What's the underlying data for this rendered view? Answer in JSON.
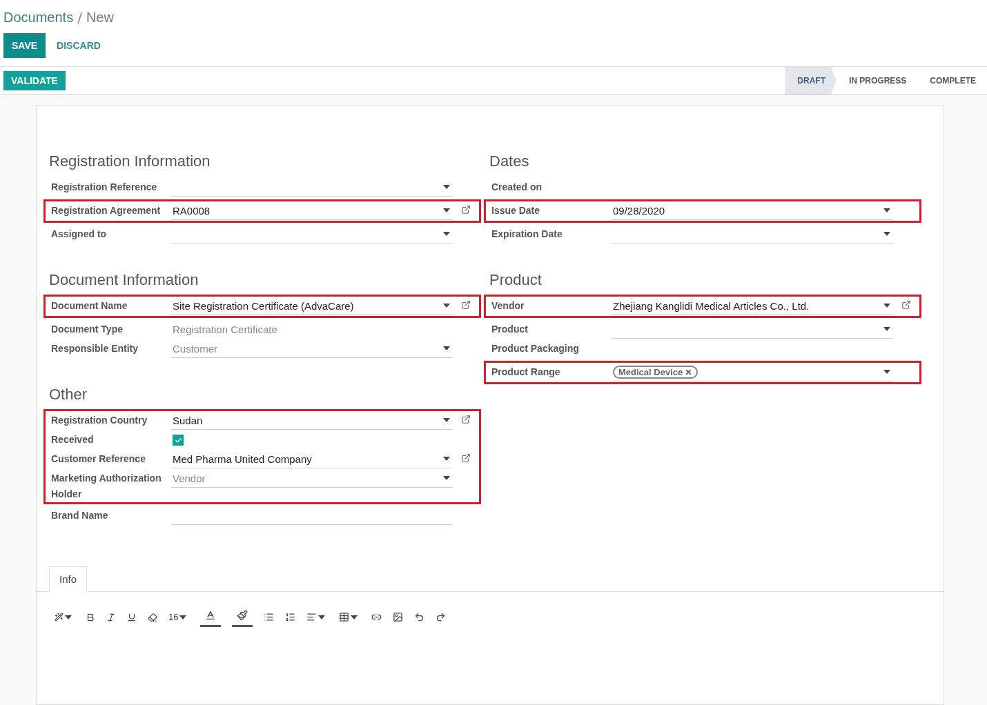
{
  "breadcrumb": {
    "parent": "Documents",
    "separator": "/",
    "current": "New"
  },
  "actions": [
    {
      "label": "SAVE",
      "kind": "primary"
    },
    {
      "label": "DISCARD",
      "kind": "link"
    }
  ],
  "validate": {
    "label": "VALIDATE"
  },
  "stages": [
    {
      "label": "DRAFT",
      "selected": true
    },
    {
      "label": "IN PROGRESS",
      "selected": false
    },
    {
      "label": "COMPLETE",
      "selected": false
    }
  ],
  "columns": [
    {
      "sections": [
        {
          "title": "Registration Information",
          "blocks": [
            {
              "fields": [
                {
                  "label": "Registration Reference",
                  "kind": "select"
                }
              ]
            },
            {
              "highlighted": true,
              "fields": [
                {
                  "label": "Registration Agreement",
                  "kind": "select",
                  "value": "RA0008",
                  "link": true
                }
              ]
            },
            {
              "fields": [
                {
                  "label": "Assigned to",
                  "kind": "select"
                }
              ]
            }
          ]
        },
        {
          "title": "Document Information",
          "blocks": [
            {
              "highlighted": true,
              "fields": [
                {
                  "label": "Document Name",
                  "kind": "select",
                  "value": "Site Registration Certificate (AdvaCare)",
                  "link": true
                }
              ]
            },
            {
              "fields": [
                {
                  "label": "Document Type",
                  "kind": "readonly",
                  "value": "Registration Certificate",
                  "muted": true
                },
                {
                  "label": "Responsible Entity",
                  "kind": "select",
                  "value": "Customer",
                  "muted": true
                }
              ]
            }
          ]
        },
        {
          "title": "Other",
          "blocks": [
            {
              "highlighted": true,
              "fields": [
                {
                  "label": "Registration Country",
                  "kind": "select",
                  "value": "Sudan",
                  "link": true
                },
                {
                  "label": "Received",
                  "kind": "checkbox",
                  "checked": true
                },
                {
                  "label": "Customer Reference",
                  "kind": "select",
                  "value": "Med Pharma United Company",
                  "link": true
                },
                {
                  "label": "Marketing Authorization Holder",
                  "kind": "select",
                  "value": "Vendor",
                  "muted": true
                }
              ]
            },
            {
              "fields": [
                {
                  "label": "Brand Name",
                  "kind": "text"
                }
              ]
            }
          ]
        }
      ]
    },
    {
      "sections": [
        {
          "title": "Dates",
          "blocks": [
            {
              "fields": [
                {
                  "label": "Created on",
                  "kind": "readonly"
                }
              ]
            },
            {
              "highlighted": true,
              "fields": [
                {
                  "label": "Issue Date",
                  "kind": "select",
                  "value": "09/28/2020"
                }
              ]
            },
            {
              "fields": [
                {
                  "label": "Expiration Date",
                  "kind": "select"
                }
              ]
            }
          ]
        },
        {
          "title": "Product",
          "blocks": [
            {
              "highlighted": true,
              "fields": [
                {
                  "label": "Vendor",
                  "kind": "select",
                  "value": "Zhejiang Kanglidi Medical Articles Co., Ltd.",
                  "link": true
                }
              ]
            },
            {
              "fields": [
                {
                  "label": "Product",
                  "kind": "select"
                },
                {
                  "label": "Product Packaging",
                  "kind": "readonly"
                }
              ]
            },
            {
              "highlighted": true,
              "fields": [
                {
                  "label": "Product Range",
                  "kind": "tags",
                  "tags": [
                    "Medical Device"
                  ]
                }
              ]
            }
          ]
        }
      ]
    }
  ],
  "notebook": {
    "tabs": [
      {
        "label": "Info",
        "selected": true
      }
    ]
  },
  "editor": {
    "font_size": "16"
  }
}
